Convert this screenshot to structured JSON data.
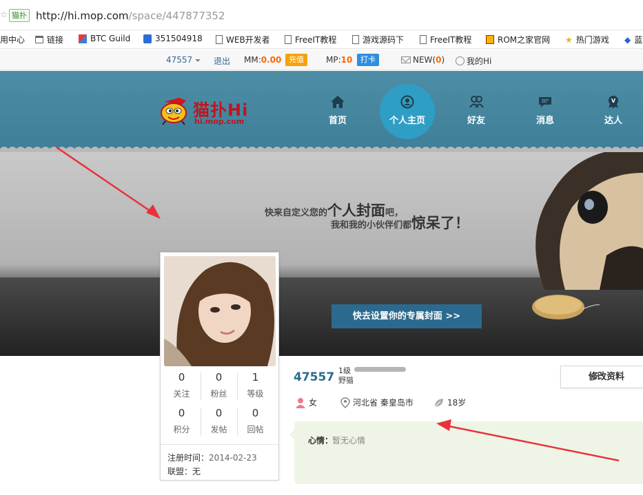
{
  "browser": {
    "site_tag": "猫扑",
    "url_host": "http://hi.mop.com",
    "url_path": "/space/447877352",
    "bookmarks": [
      {
        "label": "用中心",
        "icon": "none"
      },
      {
        "label": "链接",
        "icon": "folder-icon"
      },
      {
        "label": "BTC Guild",
        "icon": "btc-guild-icon"
      },
      {
        "label": "351504918",
        "icon": "baidu-paw-icon"
      },
      {
        "label": "WEB开发者",
        "icon": "page-icon"
      },
      {
        "label": "FreeIT教程",
        "icon": "page-icon"
      },
      {
        "label": "游戏源码下",
        "icon": "page-icon"
      },
      {
        "label": "FreeIT教程",
        "icon": "page-icon"
      },
      {
        "label": "ROM之家官网",
        "icon": "rom-icon"
      },
      {
        "label": "热门游戏",
        "icon": "star-icon"
      },
      {
        "label": "蓝",
        "icon": "gem-icon"
      }
    ]
  },
  "topbar": {
    "user_id": "47557",
    "logout": "退出",
    "mm_label": "MM:",
    "mm_value": "0.00",
    "recharge": "充值",
    "mp_label": "MP:",
    "mp_value": "10",
    "checkin": "打卡",
    "new_label": "NEW",
    "new_open": "(",
    "new_count": "0",
    "new_close": ")",
    "my_hi": "我的Hi"
  },
  "logo": {
    "name": "猫扑Hi",
    "domain": "hi.mop.com"
  },
  "nav": [
    {
      "label": "首页",
      "icon": "home-icon"
    },
    {
      "label": "个人主页",
      "icon": "user-circle-icon",
      "active": true
    },
    {
      "label": "好友",
      "icon": "friends-icon"
    },
    {
      "label": "消息",
      "icon": "message-icon"
    },
    {
      "label": "达人",
      "icon": "badge-icon"
    }
  ],
  "banner": {
    "line1_a": "快来自定义您的",
    "line1_b": "个人封面",
    "line1_c": "吧，",
    "line2_a": "我和我的小伙伴们都",
    "line2_b": "惊呆了！",
    "cover_button": "快去设置你的专属封面 >>"
  },
  "profile": {
    "stats_row1": [
      {
        "value": "0",
        "label": "关注"
      },
      {
        "value": "0",
        "label": "粉丝"
      },
      {
        "value": "1",
        "label": "等级"
      }
    ],
    "stats_row2": [
      {
        "value": "0",
        "label": "积分"
      },
      {
        "value": "0",
        "label": "发帖"
      },
      {
        "value": "0",
        "label": "回帖"
      }
    ],
    "reg_label": "注册时间：",
    "reg_value": "2014-02-23",
    "league_label": "联盟：",
    "league_value": "无",
    "username": "47557",
    "level": "1级",
    "level_progress": 0,
    "level_name": "野猫",
    "edit_button": "修改资料",
    "gender": "女",
    "location": "河北省 秦皇岛市",
    "age": "18岁",
    "mood_label": "心情：",
    "mood_value": "暂无心情"
  },
  "colors": {
    "header": "#4d8ea6",
    "nav_active": "#2f9ec4",
    "accent_link": "#336699",
    "recharge_btn": "#f7a20b",
    "checkin_btn": "#2f8ee0",
    "annotation_arrow": "#e8323a"
  }
}
